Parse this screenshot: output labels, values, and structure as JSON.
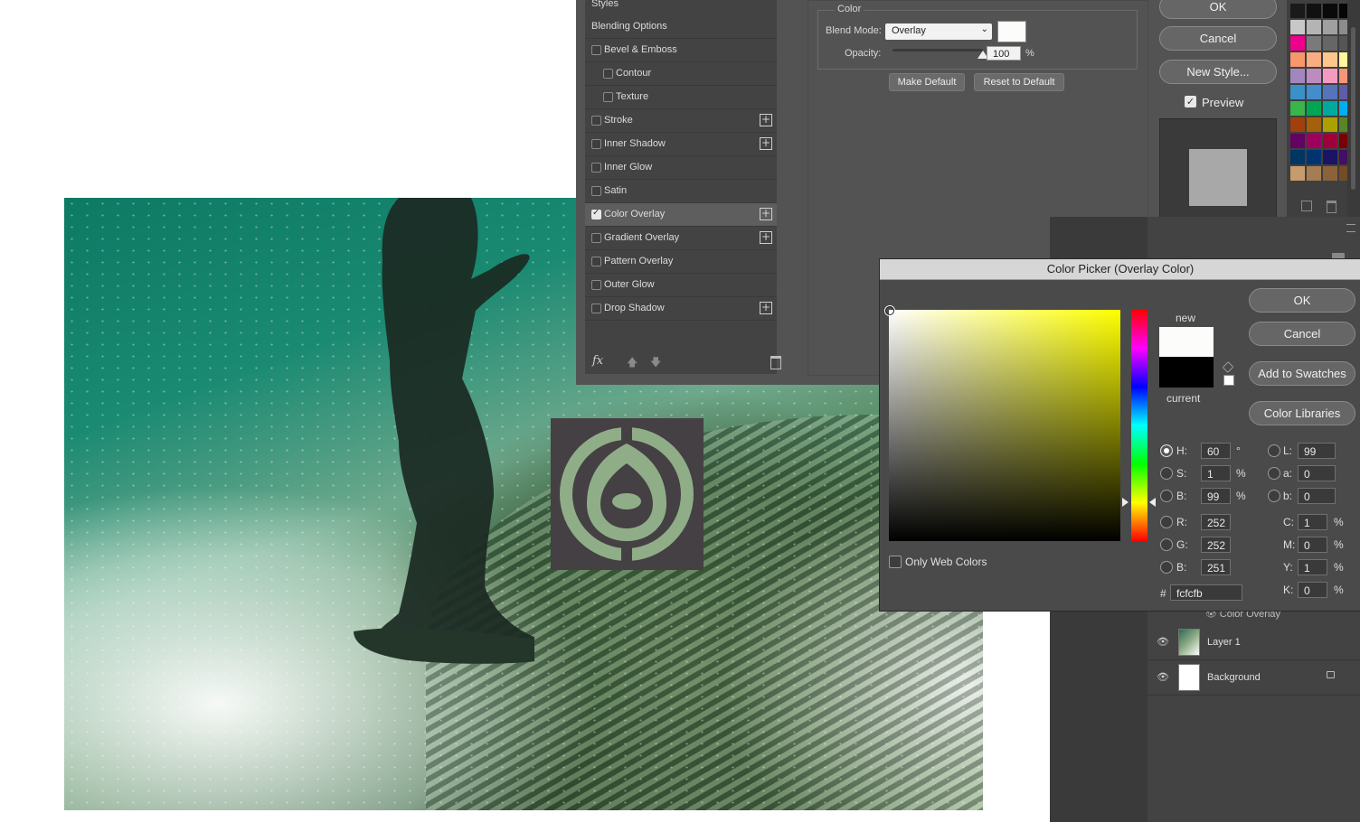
{
  "layer_style": {
    "section_title": "Styles",
    "items": [
      {
        "label": "Blending Options",
        "checkbox": false,
        "checked": false,
        "plus": false,
        "indent": false
      },
      {
        "label": "Bevel & Emboss",
        "checkbox": true,
        "checked": false,
        "plus": false,
        "indent": false
      },
      {
        "label": "Contour",
        "checkbox": true,
        "checked": false,
        "plus": false,
        "indent": true
      },
      {
        "label": "Texture",
        "checkbox": true,
        "checked": false,
        "plus": false,
        "indent": true
      },
      {
        "label": "Stroke",
        "checkbox": true,
        "checked": false,
        "plus": true,
        "indent": false
      },
      {
        "label": "Inner Shadow",
        "checkbox": true,
        "checked": false,
        "plus": true,
        "indent": false
      },
      {
        "label": "Inner Glow",
        "checkbox": true,
        "checked": false,
        "plus": false,
        "indent": false
      },
      {
        "label": "Satin",
        "checkbox": true,
        "checked": false,
        "plus": false,
        "indent": false
      },
      {
        "label": "Color Overlay",
        "checkbox": true,
        "checked": true,
        "plus": true,
        "indent": false,
        "selected": true
      },
      {
        "label": "Gradient Overlay",
        "checkbox": true,
        "checked": false,
        "plus": true,
        "indent": false
      },
      {
        "label": "Pattern Overlay",
        "checkbox": true,
        "checked": false,
        "plus": false,
        "indent": false
      },
      {
        "label": "Outer Glow",
        "checkbox": true,
        "checked": false,
        "plus": false,
        "indent": false
      },
      {
        "label": "Drop Shadow",
        "checkbox": true,
        "checked": false,
        "plus": true,
        "indent": false
      }
    ],
    "footer_icons": [
      "fx-icon",
      "move-up-icon",
      "move-down-icon",
      "trash-icon"
    ],
    "color_group_title": "Color",
    "blend_mode_label": "Blend Mode:",
    "blend_mode_value": "Overlay",
    "overlay_color": "#fcfcfb",
    "opacity_label": "Opacity:",
    "opacity_value": "100",
    "opacity_unit": "%",
    "opacity_fraction": 1.0,
    "make_default": "Make Default",
    "reset_default": "Reset to Default",
    "ok": "OK",
    "cancel": "Cancel",
    "new_style": "New Style...",
    "preview_label": "Preview",
    "preview_checked": true
  },
  "color_picker": {
    "title": "Color Picker (Overlay Color)",
    "new_label": "new",
    "current_label": "current",
    "new_color": "#fcfcfb",
    "current_color": "#000000",
    "ok": "OK",
    "cancel": "Cancel",
    "add_to_swatches": "Add to Swatches",
    "color_libraries": "Color Libraries",
    "only_web_colors": "Only Web Colors",
    "hsb": [
      {
        "label": "H:",
        "value": "60",
        "unit": "°",
        "selected": true
      },
      {
        "label": "S:",
        "value": "1",
        "unit": "%",
        "selected": false
      },
      {
        "label": "B:",
        "value": "99",
        "unit": "%",
        "selected": false
      }
    ],
    "rgb": [
      {
        "label": "R:",
        "value": "252",
        "unit": ""
      },
      {
        "label": "G:",
        "value": "252",
        "unit": ""
      },
      {
        "label": "B:",
        "value": "251",
        "unit": ""
      }
    ],
    "lab": [
      {
        "label": "L:",
        "value": "99"
      },
      {
        "label": "a:",
        "value": "0"
      },
      {
        "label": "b:",
        "value": "0"
      }
    ],
    "cmyk": [
      {
        "label": "C:",
        "value": "1",
        "unit": "%"
      },
      {
        "label": "M:",
        "value": "0",
        "unit": "%"
      },
      {
        "label": "Y:",
        "value": "1",
        "unit": "%"
      },
      {
        "label": "K:",
        "value": "0",
        "unit": "%"
      }
    ],
    "hex_label": "#",
    "hex_value": "fcfcfb"
  },
  "layers": {
    "effect_row": "Color Overlay",
    "rows": [
      {
        "name": "Layer 1",
        "locked": false
      },
      {
        "name": "Background",
        "locked": true
      }
    ]
  },
  "swatch_colors": [
    [
      "#1a1a1a",
      "#111111",
      "#0a0a0a",
      "#050505"
    ],
    [
      "#c8c8c8",
      "#b4b4b4",
      "#a0a0a0",
      "#8c8c8c"
    ],
    [
      "#ec008c",
      "#7a7a7a",
      "#666666",
      "#555555"
    ],
    [
      "#f7976a",
      "#f9ad81",
      "#fdc68a",
      "#fff799"
    ],
    [
      "#a187be",
      "#bd8cbf",
      "#f49ac1",
      "#f69679"
    ],
    [
      "#3a90c8",
      "#448ccb",
      "#5674b9",
      "#605ca8"
    ],
    [
      "#39b54a",
      "#00a651",
      "#00a99d",
      "#00aeef"
    ],
    [
      "#a0410d",
      "#a36209",
      "#aba000",
      "#598527"
    ],
    [
      "#630460",
      "#9e005d",
      "#9e0039",
      "#790000"
    ],
    [
      "#003663",
      "#003471",
      "#1b1464",
      "#440e62"
    ],
    [
      "#c69c6d",
      "#a67c52",
      "#8c6239",
      "#754c24"
    ]
  ]
}
